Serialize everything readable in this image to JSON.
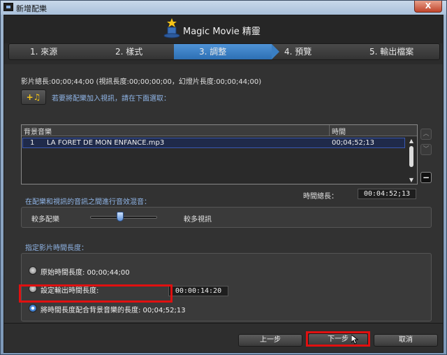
{
  "window": {
    "title": "新增配樂",
    "close_label": "X"
  },
  "header": {
    "logo_text": "Magic Movie 精靈"
  },
  "steps": [
    {
      "label": "1. 來源"
    },
    {
      "label": "2. 樣式"
    },
    {
      "label": "3. 調整"
    },
    {
      "label": "4. 預覽"
    },
    {
      "label": "5. 輸出檔案"
    }
  ],
  "info": {
    "durations": "影片總長:00;00;44;00 (視訊長度:00;00;00;00，幻燈片長度:00;00;44;00)"
  },
  "add_music": {
    "button_label": "+♫",
    "hint": "若要將配樂加入視訊，請在下面選取："
  },
  "music_list": {
    "columns": {
      "background_music": "背景音樂",
      "time": "時間"
    },
    "rows": [
      {
        "index": "1",
        "name": "LA FORET DE MON ENFANCE.mp3",
        "time": "00;04;52;13"
      }
    ]
  },
  "total_time": {
    "label": "時間總長：",
    "value": "00:04:52;13"
  },
  "mix": {
    "title": "在配樂和視訊的音訊之間進行音效混音：",
    "left_label": "較多配樂",
    "right_label": "較多視訊",
    "level": 0.45
  },
  "duration": {
    "title": "指定影片時間長度：",
    "option_original": "原始時間長度: 00;00;44;00",
    "option_custom": "設定輸出時間長度:",
    "custom_value": "00:00:14:20",
    "option_match": "將時間長度配合背景音樂的長度: 00;04;52;13",
    "selected": "option_match"
  },
  "footer": {
    "prev_label": "上一步",
    "next_label": "下一步",
    "cancel_label": "取消"
  },
  "colors": {
    "accent": "#3a7fc4",
    "highlight": "#e01010"
  }
}
